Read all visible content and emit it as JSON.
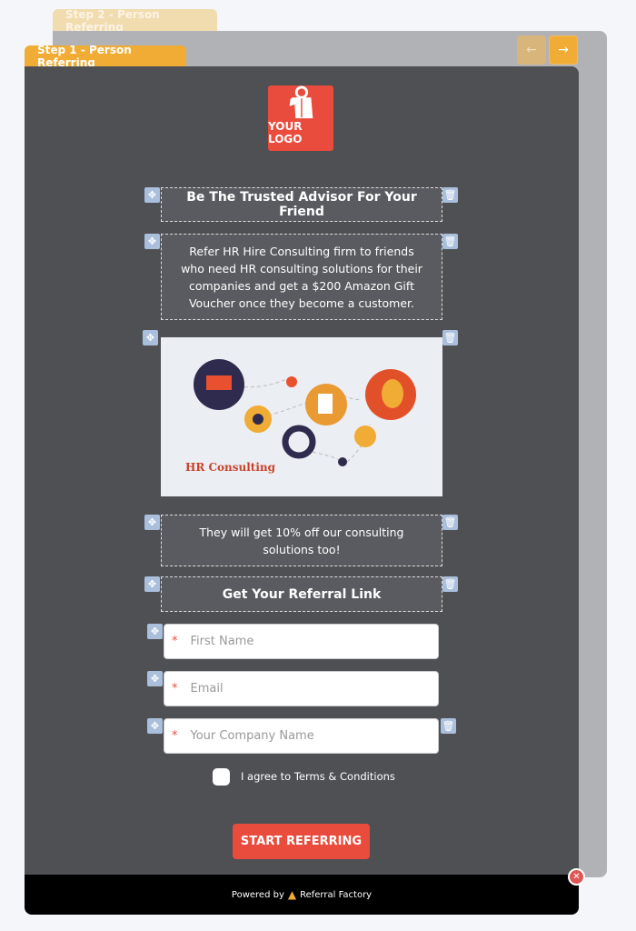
{
  "tabs": {
    "step2": "Step 2 - Person Referring",
    "step1": "Step 1 - Person Referring"
  },
  "nav": {
    "prev_icon": "arrow-left-icon",
    "next_icon": "arrow-right-icon",
    "prev": "←",
    "next": "→"
  },
  "logo": {
    "text": "YOUR LOGO"
  },
  "title": "Be The Trusted Advisor For Your Friend",
  "description": "Refer HR Hire Consulting firm to friends who need HR consulting solutions for their companies and get a $200 Amazon Gift Voucher once they become a customer.",
  "image": {
    "caption": "HR Consulting"
  },
  "friend_offer": "They will get 10% off our consulting solutions too!",
  "link_heading": "Get Your Referral Link",
  "fields": [
    {
      "placeholder": "First Name",
      "required": "*"
    },
    {
      "placeholder": "Email",
      "required": "*"
    },
    {
      "placeholder": "Your Company Name",
      "required": "*"
    }
  ],
  "terms": "I agree to Terms & Conditions",
  "submit": "START REFERRING",
  "footer": {
    "powered_by": "Powered by",
    "brand": "Referral Factory"
  },
  "colors": {
    "accent": "#f0ac34",
    "button": "#e94b3c",
    "panel": "#4f5054"
  }
}
